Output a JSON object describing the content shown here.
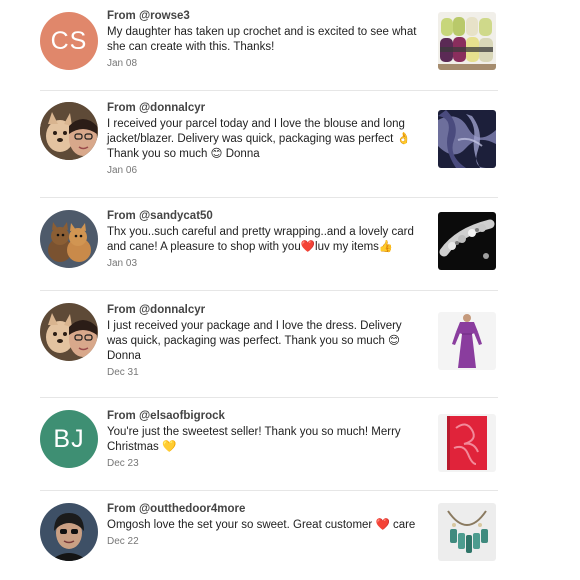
{
  "reviews": [
    {
      "from_prefix": "From ",
      "handle": "@rowse3",
      "text": "My daughter has taken up crochet and is excited to see what she can create with this. Thanks!",
      "date": "Jan 08",
      "avatar_initials": "CS",
      "avatar_color": "#e0876b"
    },
    {
      "from_prefix": "From ",
      "handle": "@donnalcyr",
      "text": "I received your parcel today and I love the blouse and long jacket/blazer. Delivery was quick, packaging was perfect 👌 Thank you so much 😊  Donna",
      "date": "Jan 06"
    },
    {
      "from_prefix": "From ",
      "handle": "@sandycat50",
      "text": "Thx you..such careful and pretty wrapping..and a lovely card and cane! A pleasure to shop with you❤️luv my items👍",
      "date": "Jan 03"
    },
    {
      "from_prefix": "From ",
      "handle": "@donnalcyr",
      "text": "I just received your package and I love the dress. Delivery was quick, packaging was perfect. Thank you so much 😊 Donna",
      "date": "Dec 31"
    },
    {
      "from_prefix": "From ",
      "handle": "@elsaofbigrock",
      "text": "You're just the sweetest seller! Thank you so much! Merry Christmas 💛",
      "date": "Dec 23",
      "avatar_initials": "BJ",
      "avatar_color": "#3e8f73"
    },
    {
      "from_prefix": "From ",
      "handle": "@outthedoor4more",
      "text": "Omgosh love the set your so sweet. Great customer ❤️ care",
      "date": "Dec 22"
    }
  ]
}
